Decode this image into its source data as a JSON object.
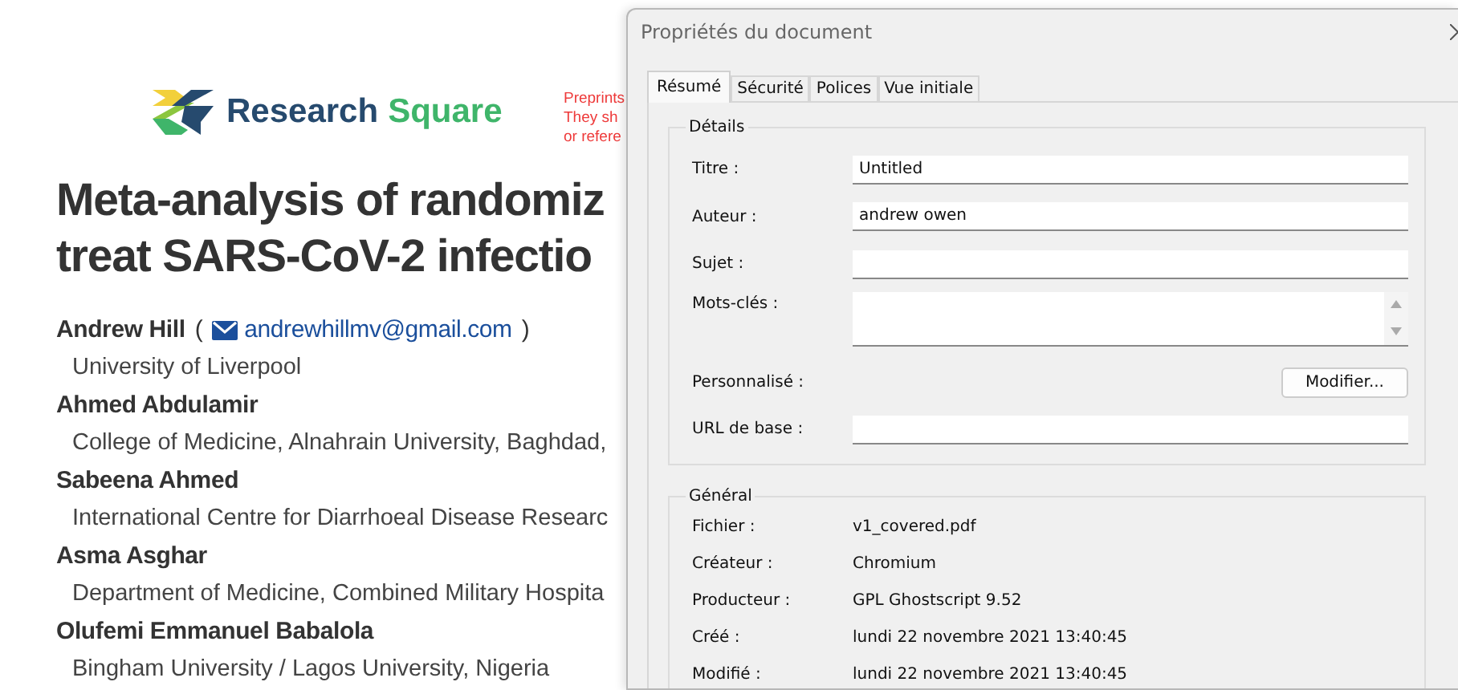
{
  "document": {
    "logo": {
      "word_1": "Research",
      "word_2": "Square"
    },
    "notice_lines": [
      "Preprints",
      "They sh",
      "or refere"
    ],
    "title_lines": [
      "Meta-analysis of randomiz",
      "treat SARS-CoV-2 infectio"
    ],
    "authors": [
      {
        "name": "Andrew Hill",
        "open_paren": "(",
        "email": "andrewhillmv@gmail.com",
        "close_paren": ")",
        "affiliation": "University of Liverpool"
      },
      {
        "name": "Ahmed Abdulamir",
        "affiliation": "College of Medicine, Alnahrain University, Baghdad,"
      },
      {
        "name": "Sabeena Ahmed",
        "affiliation": "International Centre for Diarrhoeal Disease Researc"
      },
      {
        "name": "Asma Asghar",
        "affiliation": "Department of Medicine, Combined Military Hospita"
      },
      {
        "name": "Olufemi Emmanuel Babalola",
        "affiliation": "Bingham University / Lagos University, Nigeria"
      }
    ]
  },
  "dialog": {
    "title": "Propriétés du document",
    "tabs": [
      {
        "label": "Résumé",
        "selected": true
      },
      {
        "label": "Sécurité",
        "selected": false
      },
      {
        "label": "Polices",
        "selected": false
      },
      {
        "label": "Vue initiale",
        "selected": false
      }
    ],
    "details": {
      "legend": "Détails",
      "fields": [
        {
          "kind": "text",
          "label": "Titre :",
          "value": "Untitled"
        },
        {
          "kind": "text",
          "label": "Auteur :",
          "value": "andrew owen"
        },
        {
          "kind": "text",
          "label": "Sujet :"
        },
        {
          "kind": "textarea",
          "label": "Mots-clés :"
        },
        {
          "kind": "button",
          "label": "Personnalisé :",
          "button": "Modifier..."
        },
        {
          "kind": "text",
          "label": "URL de base :"
        }
      ]
    },
    "general": {
      "legend": "Général",
      "rows": [
        {
          "label": "Fichier :",
          "value": "v1_covered.pdf"
        },
        {
          "label": "Créateur :",
          "value": "Chromium"
        },
        {
          "label": "Producteur :",
          "value": "GPL Ghostscript 9.52"
        },
        {
          "label": "Créé :",
          "value": "lundi 22 novembre 2021 13:40:45"
        },
        {
          "label": "Modifié :",
          "value": "lundi 22 novembre 2021 13:40:45"
        }
      ]
    }
  }
}
